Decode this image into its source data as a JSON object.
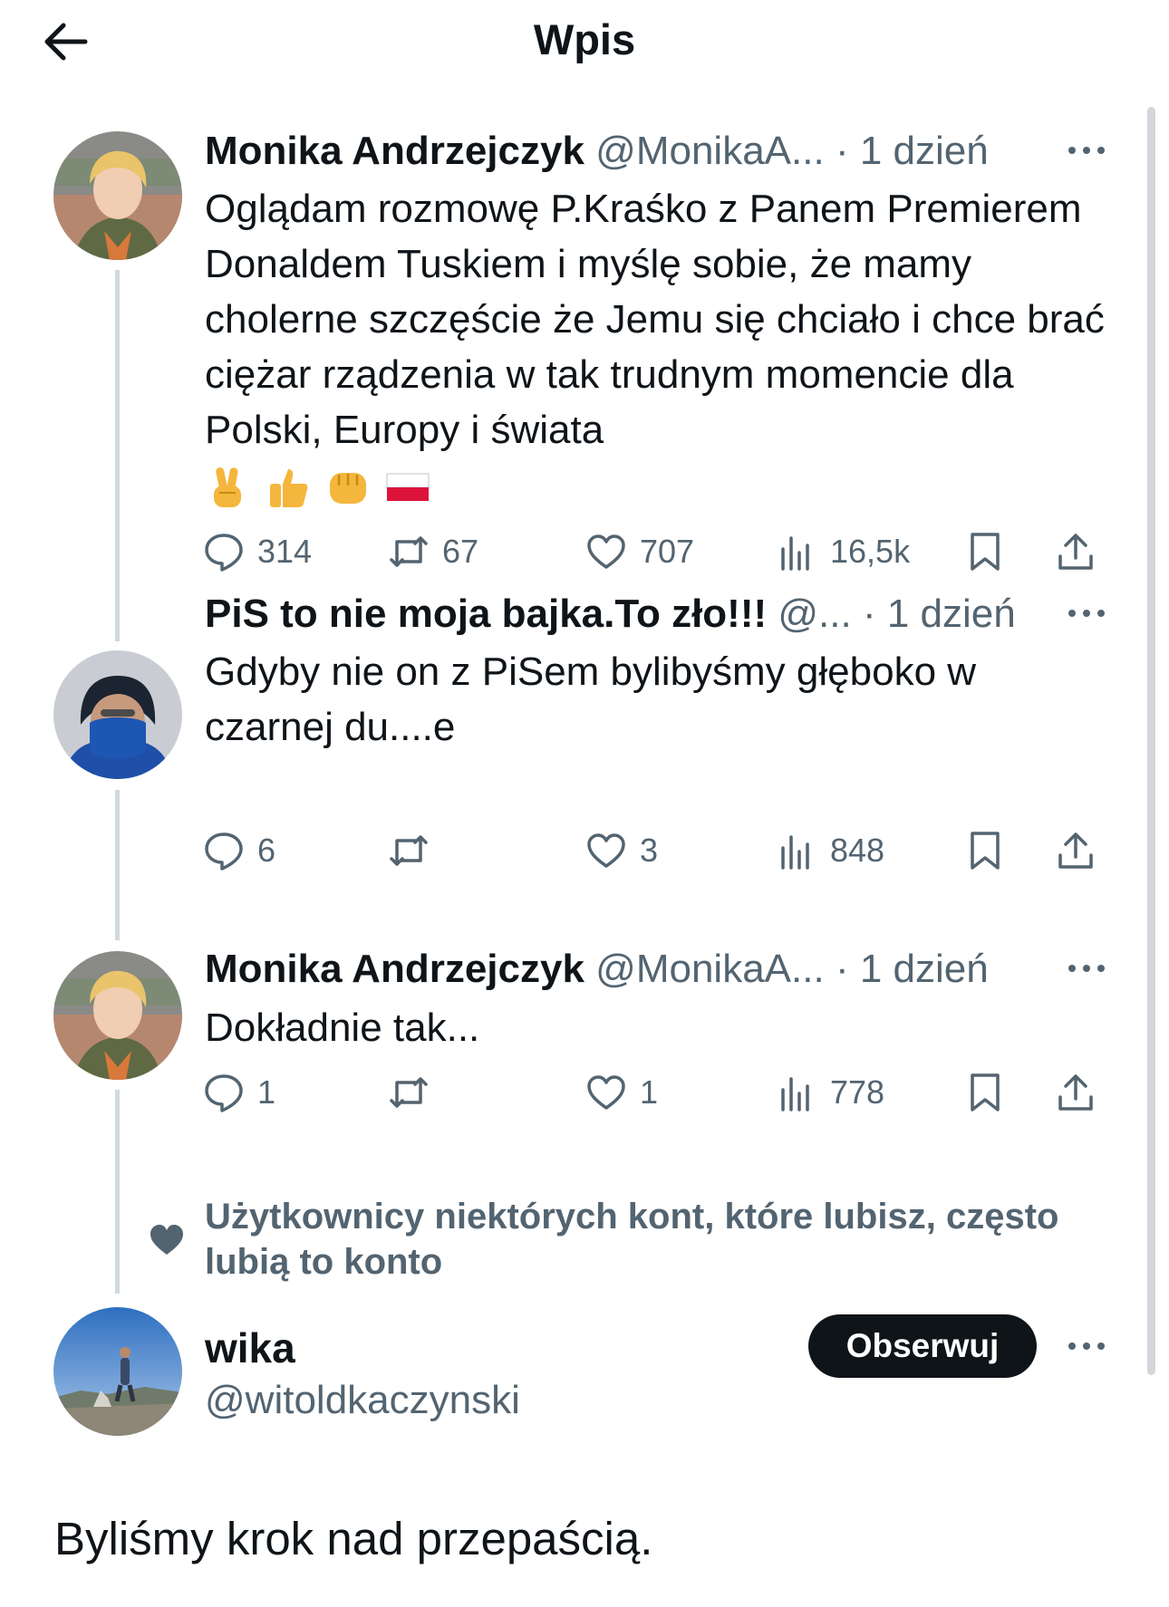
{
  "header": {
    "title": "Wpis",
    "back_icon": "arrow-left-icon"
  },
  "colors": {
    "text": "#0f1419",
    "secondary": "#536471",
    "thread_line": "#cfd9de",
    "button_bg": "#0f1419",
    "button_text": "#ffffff"
  },
  "tweets": [
    {
      "name": "Monika Andrzejczyk",
      "handle": "@MonikaA...",
      "dot": "·",
      "time": "1 dzień",
      "text": "Oglądam rozmowę P.Kraśko z Panem Premierem Donaldem Tuskiem i myślę sobie, że mamy cholerne szczęście że Jemu się chciało i chce brać ciężar rządzenia w tak trudnym momencie dla Polski, Europy i świata",
      "emojis": [
        "victory-hand-icon",
        "thumbs-up-icon",
        "fist-icon",
        "poland-flag-icon"
      ],
      "replies": "314",
      "reposts": "67",
      "likes": "707",
      "views": "16,5k"
    },
    {
      "name": "PiS to nie moja bajka.To zło!!!",
      "handle": "@...",
      "dot": "·",
      "time": "1 dzień",
      "text": "Gdyby nie on z PiSem bylibyśmy głęboko w czarnej du....e",
      "replies": "6",
      "reposts": "",
      "likes": "3",
      "views": "848"
    },
    {
      "name": "Monika Andrzejczyk",
      "handle": "@MonikaA...",
      "dot": "·",
      "time": "1 dzień",
      "text": "Dokładnie tak...",
      "replies": "1",
      "reposts": "",
      "likes": "1",
      "views": "778"
    }
  ],
  "social_context": {
    "text": "Użytkownicy niektórych kont, które lubisz, często lubią to konto",
    "icon": "heart-filled-icon"
  },
  "follow": {
    "name": "wika",
    "handle": "@witoldkaczynski",
    "button": "Obserwuj"
  },
  "main_post": {
    "text": "Byliśmy krok nad przepaścią."
  }
}
